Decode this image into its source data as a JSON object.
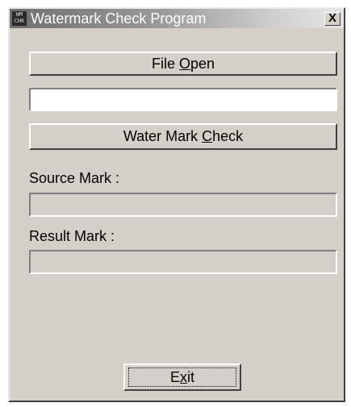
{
  "window": {
    "title": "Watermark Check Program",
    "icon_text": [
      "WM",
      "CHK"
    ],
    "close_label": "X"
  },
  "buttons": {
    "file_open": {
      "before": "File ",
      "mnemonic": "O",
      "after": "pen"
    },
    "water_mark_check": {
      "before": "Water Mark ",
      "mnemonic": "C",
      "after": "heck"
    },
    "exit": {
      "before": "E",
      "mnemonic": "x",
      "after": "it"
    }
  },
  "fields": {
    "file_path": {
      "value": ""
    },
    "source_mark": {
      "label": "Source Mark :",
      "value": ""
    },
    "result_mark": {
      "label": "Result Mark  :",
      "value": ""
    }
  }
}
